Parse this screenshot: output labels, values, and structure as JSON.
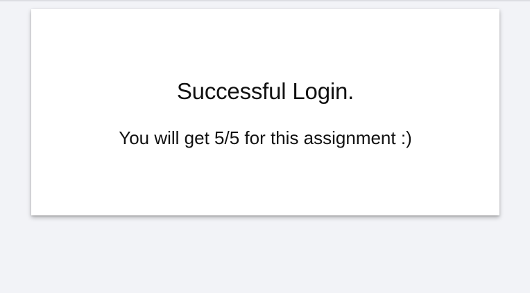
{
  "card": {
    "title": "Successful Login.",
    "message": "You will get 5/5 for this assignment :)"
  },
  "colors": {
    "background": "#f2f3f7",
    "card": "#ffffff",
    "text": "#111111"
  }
}
